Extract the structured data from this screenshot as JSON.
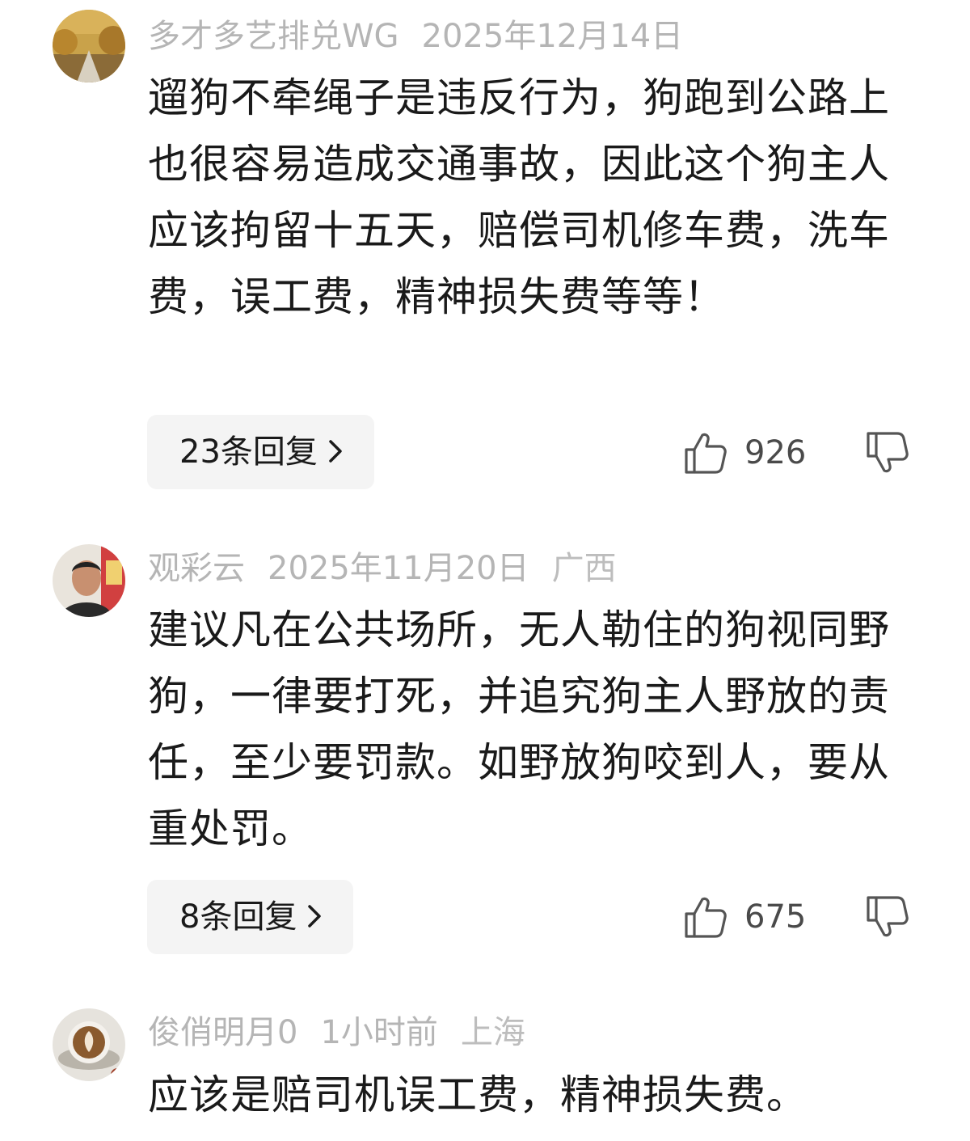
{
  "comments": [
    {
      "username": "多才多艺排兑WG",
      "date": "2025年12月14日",
      "location": "",
      "text": "遛狗不牵绳子是违反行为，狗跑到公路上也很容易造成交通事故，因此这个狗主人应该拘留十五天，赔偿司机修车费，洗车费，误工费，精神损失费等等！",
      "replies": "23条回复",
      "likes": "926"
    },
    {
      "username": "观彩云",
      "date": "2025年11月20日",
      "location": "广西",
      "text": "建议凡在公共场所，无人勒住的狗视同野狗，一律要打死，并追究狗主人野放的责任，至少要罚款。如野放狗咬到人，要从重处罚。",
      "replies": "8条回复",
      "likes": "675"
    },
    {
      "username": "俊俏明月0",
      "date": "1小时前",
      "location": "上海",
      "text": "应该是赔司机误工费，精神损失费。"
    }
  ]
}
